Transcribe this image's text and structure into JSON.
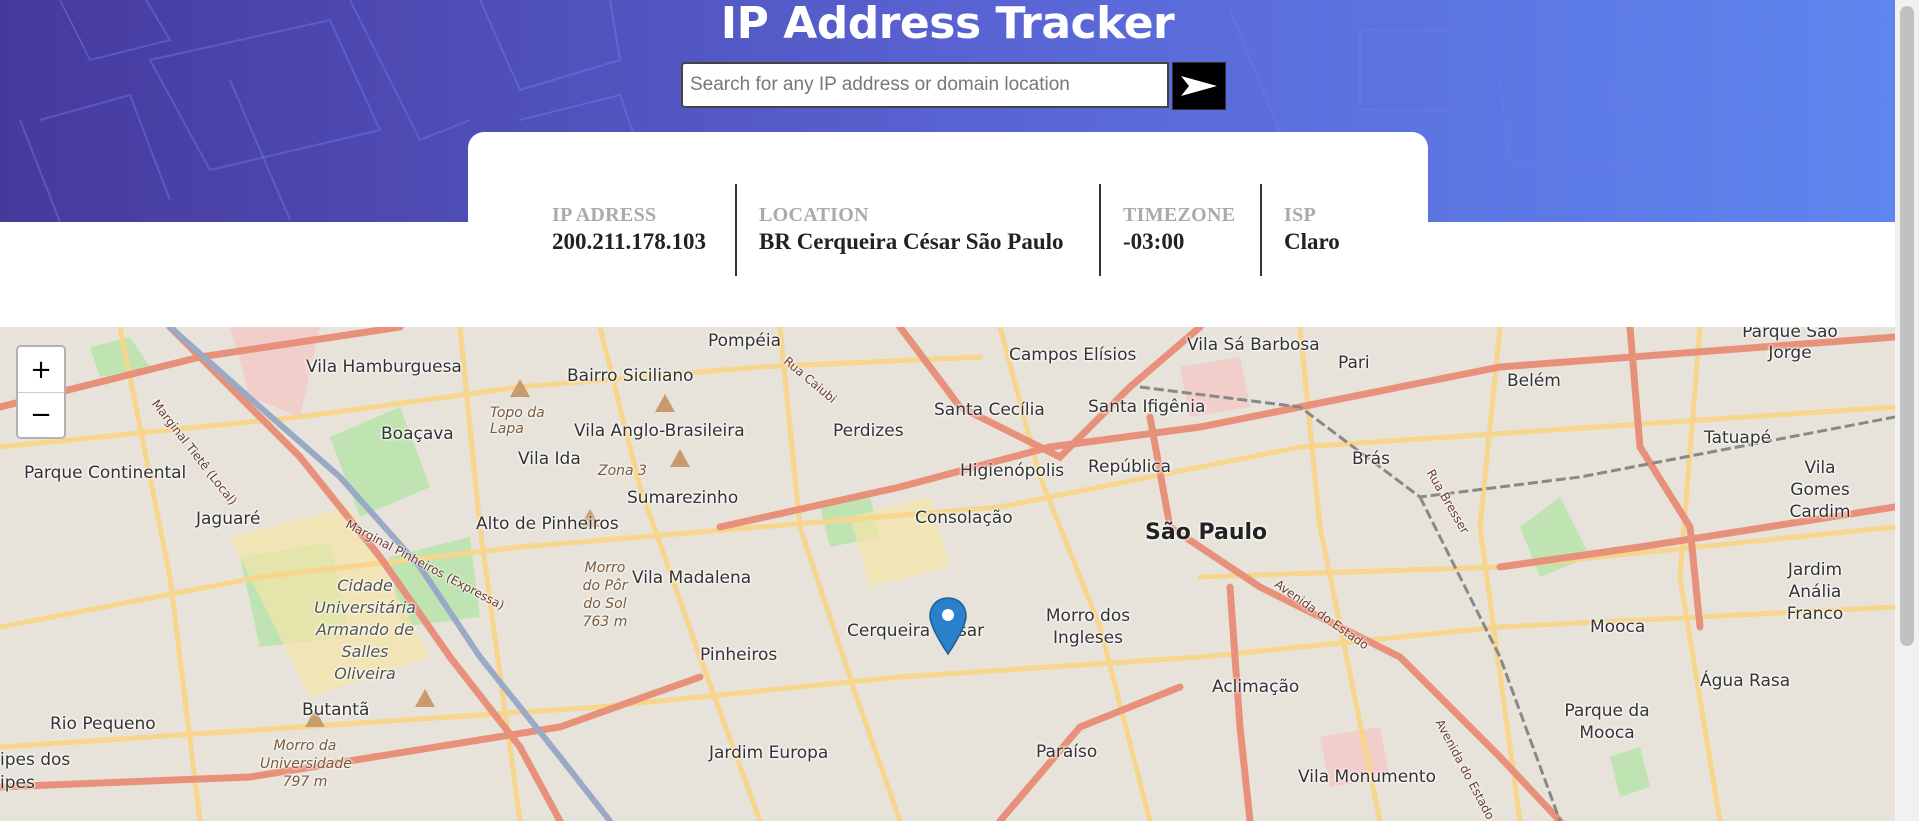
{
  "header": {
    "title": "IP Address Tracker",
    "search_placeholder": "Search for any IP address or domain location",
    "search_value": "",
    "submit_icon": "arrow-right-icon"
  },
  "info": [
    {
      "label": "IP ADRESS",
      "value": "200.211.178.103"
    },
    {
      "label": "LOCATION",
      "value": "BR Cerqueira César São Paulo"
    },
    {
      "label": "TIMEZONE",
      "value": "-03:00"
    },
    {
      "label": "ISP",
      "value": "Claro"
    }
  ],
  "map": {
    "zoom_in": "+",
    "zoom_out": "−",
    "marker_icon": "map-marker-icon",
    "place_labels": [
      "Pompéia",
      "Campos Elísios",
      "Vila Sá Barbosa",
      "Pari",
      "Belém",
      "Parque São Jorge",
      "Vila Hamburguesa",
      "Bairro Siciliano",
      "Rua Caiubi",
      "Santa Cecília",
      "Santa Ifigênia",
      "Topo da Lapa",
      "Boaçava",
      "Vila Anglo-Brasileira",
      "Perdizes",
      "Tatuapé",
      "Vila Ida",
      "Zona 3",
      "Higienópolis",
      "República",
      "Brás",
      "Parque Continental",
      "Sumarezinho",
      "Vila Gomes Cardim",
      "Jaguaré",
      "Alto de Pinheiros",
      "Consolação",
      "São Paulo",
      "Marginal Tietê (Local)",
      "Marginal Pinheiros (Expressa)",
      "Cidade Universitária Armando de Salles Oliveira",
      "Morro do Pôr do Sol 763 m",
      "Vila Madalena",
      "Avenida do Estado",
      "Jardim Anália Franco",
      "Morro dos Ingleses",
      "Cerqueira César",
      "Pinheiros",
      "Mooca",
      "Butantã",
      "Aclimação",
      "Água Rasa",
      "Rio Pequeno",
      "Morro da Universidade 797 m",
      "Parque da Mooca",
      "Jardim Europa",
      "Paraíso",
      "Vila Monumento",
      "Rua Bresser",
      "Avenida do Estado",
      "ipes dos",
      "ipes"
    ],
    "colors": {
      "land": "#f2efe9",
      "major_road": "#e8917a",
      "secondary_road": "#f7d58c",
      "residential": "#e0dcd4",
      "park": "#bfe3b1",
      "water": "#aad3df",
      "marker": "#2a81cb"
    }
  },
  "colors": {
    "header_start": "#46399c",
    "header_end": "#5e86ee",
    "label": "#aaaaaa",
    "value": "#222222"
  }
}
